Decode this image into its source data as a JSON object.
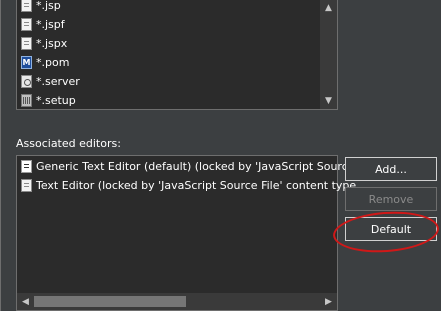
{
  "file_types": [
    {
      "label": "*.jsp",
      "icon": "jsp-file-icon"
    },
    {
      "label": "*.jspf",
      "icon": "jspf-file-icon"
    },
    {
      "label": "*.jspx",
      "icon": "jspx-file-icon"
    },
    {
      "label": "*.pom",
      "icon": "maven-pom-icon",
      "glyph": "M"
    },
    {
      "label": "*.server",
      "icon": "server-file-icon"
    },
    {
      "label": "*.setup",
      "icon": "setup-file-icon"
    }
  ],
  "associated_editors": {
    "label": "Associated editors:",
    "items": [
      {
        "label": "Generic Text Editor (default) (locked by 'JavaScript Source",
        "icon": "generic-text-editor-icon"
      },
      {
        "label": "Text Editor (locked by 'JavaScript Source File' content type",
        "icon": "text-editor-icon"
      }
    ]
  },
  "buttons": {
    "add": "Add...",
    "remove": "Remove",
    "default": "Default"
  },
  "scroll": {
    "up": "▲",
    "down": "▼",
    "left": "◀",
    "right": "▶"
  },
  "colors": {
    "background": "#3c3f41",
    "list_background": "#2b2b2b",
    "annotation": "#d01818"
  }
}
